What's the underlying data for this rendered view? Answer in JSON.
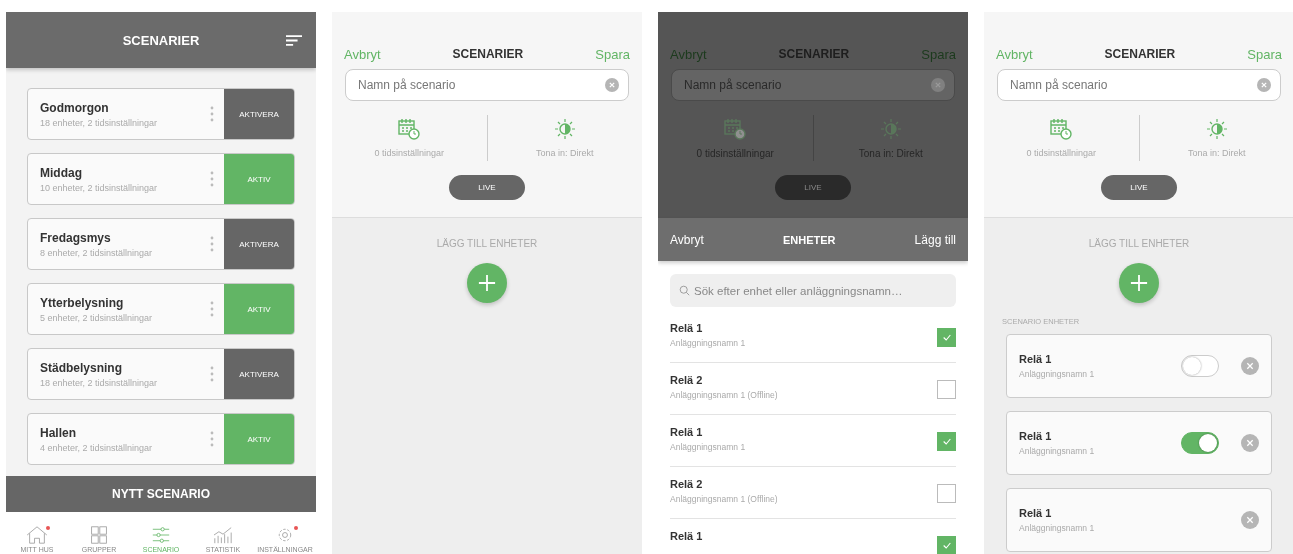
{
  "screens": [
    {
      "kind": "list",
      "title": "SCENARIER",
      "scenes": [
        {
          "name": "Godmorgon",
          "detail": "18 enheter, 2 tidsinställningar",
          "action": "AKTIVERA",
          "active": false
        },
        {
          "name": "Middag",
          "detail": "10 enheter, 2 tidsinställningar",
          "action": "AKTIV",
          "active": true
        },
        {
          "name": "Fredagsmys",
          "detail": "8 enheter, 2 tidsinställningar",
          "action": "AKTIVERA",
          "active": false
        },
        {
          "name": "Ytterbelysning",
          "detail": "5 enheter, 2 tidsinställningar",
          "action": "AKTIV",
          "active": true
        },
        {
          "name": "Städbelysning",
          "detail": "18 enheter, 2 tidsinställningar",
          "action": "AKTIVERA",
          "active": false
        },
        {
          "name": "Hallen",
          "detail": "4 enheter, 2 tidsinställningar",
          "action": "AKTIV",
          "active": true
        }
      ],
      "new_button": "NYTT SCENARIO",
      "tabs": [
        {
          "kind": "home",
          "label": "MITT HUS",
          "selected": false,
          "badge": true
        },
        {
          "kind": "groups",
          "label": "GRUPPER",
          "selected": false,
          "badge": false
        },
        {
          "kind": "scenes",
          "label": "SCENARIO",
          "selected": true,
          "badge": false
        },
        {
          "kind": "stats",
          "label": "STATISTIK",
          "selected": false,
          "badge": false
        },
        {
          "kind": "settings",
          "label": "INSTÄLLNINGAR",
          "selected": false,
          "badge": true
        }
      ]
    },
    {
      "kind": "editor",
      "editor": {
        "cancel": "Avbryt",
        "title": "SCENARIER",
        "save": "Spara",
        "name_placeholder": "Namn på scenario",
        "schedules": "0 tidsinställningar",
        "fade": "Tona in: Direkt",
        "live": "LIVE",
        "add_label": "LÄGG TILL ENHETER"
      }
    },
    {
      "kind": "picker",
      "editor": {
        "cancel": "Avbryt",
        "title": "SCENARIER",
        "save": "Spara",
        "name_placeholder": "Namn på scenario",
        "schedules": "0 tidsinställningar",
        "fade": "Tona in: Direkt",
        "live": "LIVE"
      },
      "sheet": {
        "cancel": "Avbryt",
        "title": "ENHETER",
        "confirm": "Lägg till",
        "search_placeholder": "Sök efter enhet eller anläggningsnamn…",
        "devices": [
          {
            "name": "Relä 1",
            "site": "Anläggningsnamn 1",
            "checked": true
          },
          {
            "name": "Relä 2",
            "site": "Anläggningsnamn 1 (Offline)",
            "checked": false
          },
          {
            "name": "Relä 1",
            "site": "Anläggningsnamn 1",
            "checked": true
          },
          {
            "name": "Relä 2",
            "site": "Anläggningsnamn 1 (Offline)",
            "checked": false
          },
          {
            "name": "Relä 1",
            "checked": true
          }
        ]
      }
    },
    {
      "kind": "editor",
      "editor": {
        "cancel": "Avbryt",
        "title": "SCENARIER",
        "save": "Spara",
        "name_placeholder": "Namn på scenario",
        "schedules": "0 tidsinställningar",
        "fade": "Tona in: Direkt",
        "live": "LIVE",
        "add_label": "LÄGG TILL ENHETER",
        "section_label": "SCENARIO ENHETER",
        "devices": [
          {
            "kind": "switch",
            "name": "Relä 1",
            "site": "Anläggningsnamn 1",
            "on": false
          },
          {
            "kind": "switch",
            "name": "Relä 1",
            "site": "Anläggningsnamn 1",
            "on": true
          },
          {
            "kind": "plain",
            "name": "Relä 1",
            "site": "Anläggningsnamn 1"
          }
        ]
      }
    }
  ]
}
